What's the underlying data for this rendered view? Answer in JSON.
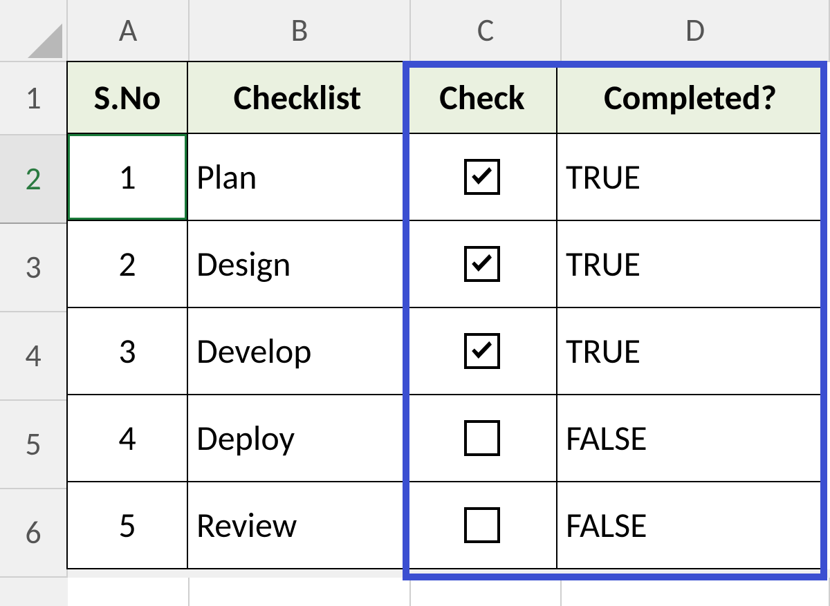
{
  "columns": {
    "A": "A",
    "B": "B",
    "C": "C",
    "D": "D"
  },
  "row_labels": [
    "1",
    "2",
    "3",
    "4",
    "5",
    "6"
  ],
  "headers": {
    "sno": "S.No",
    "checklist": "Checklist",
    "check": "Check",
    "completed": "Completed?"
  },
  "rows": [
    {
      "sno": "1",
      "checklist": "Plan",
      "checked": true,
      "completed": "TRUE"
    },
    {
      "sno": "2",
      "checklist": "Design",
      "checked": true,
      "completed": "TRUE"
    },
    {
      "sno": "3",
      "checklist": "Develop",
      "checked": true,
      "completed": "TRUE"
    },
    {
      "sno": "4",
      "checklist": "Deploy",
      "checked": false,
      "completed": "FALSE"
    },
    {
      "sno": "5",
      "checklist": "Review",
      "checked": false,
      "completed": "FALSE"
    }
  ],
  "active_cell": "A2",
  "selection_highlight_columns": [
    "C",
    "D"
  ],
  "colors": {
    "header_fill": "#eaf1e0",
    "selection_border": "#3b4fd1",
    "active_cell_border": "#1a7b3a"
  }
}
